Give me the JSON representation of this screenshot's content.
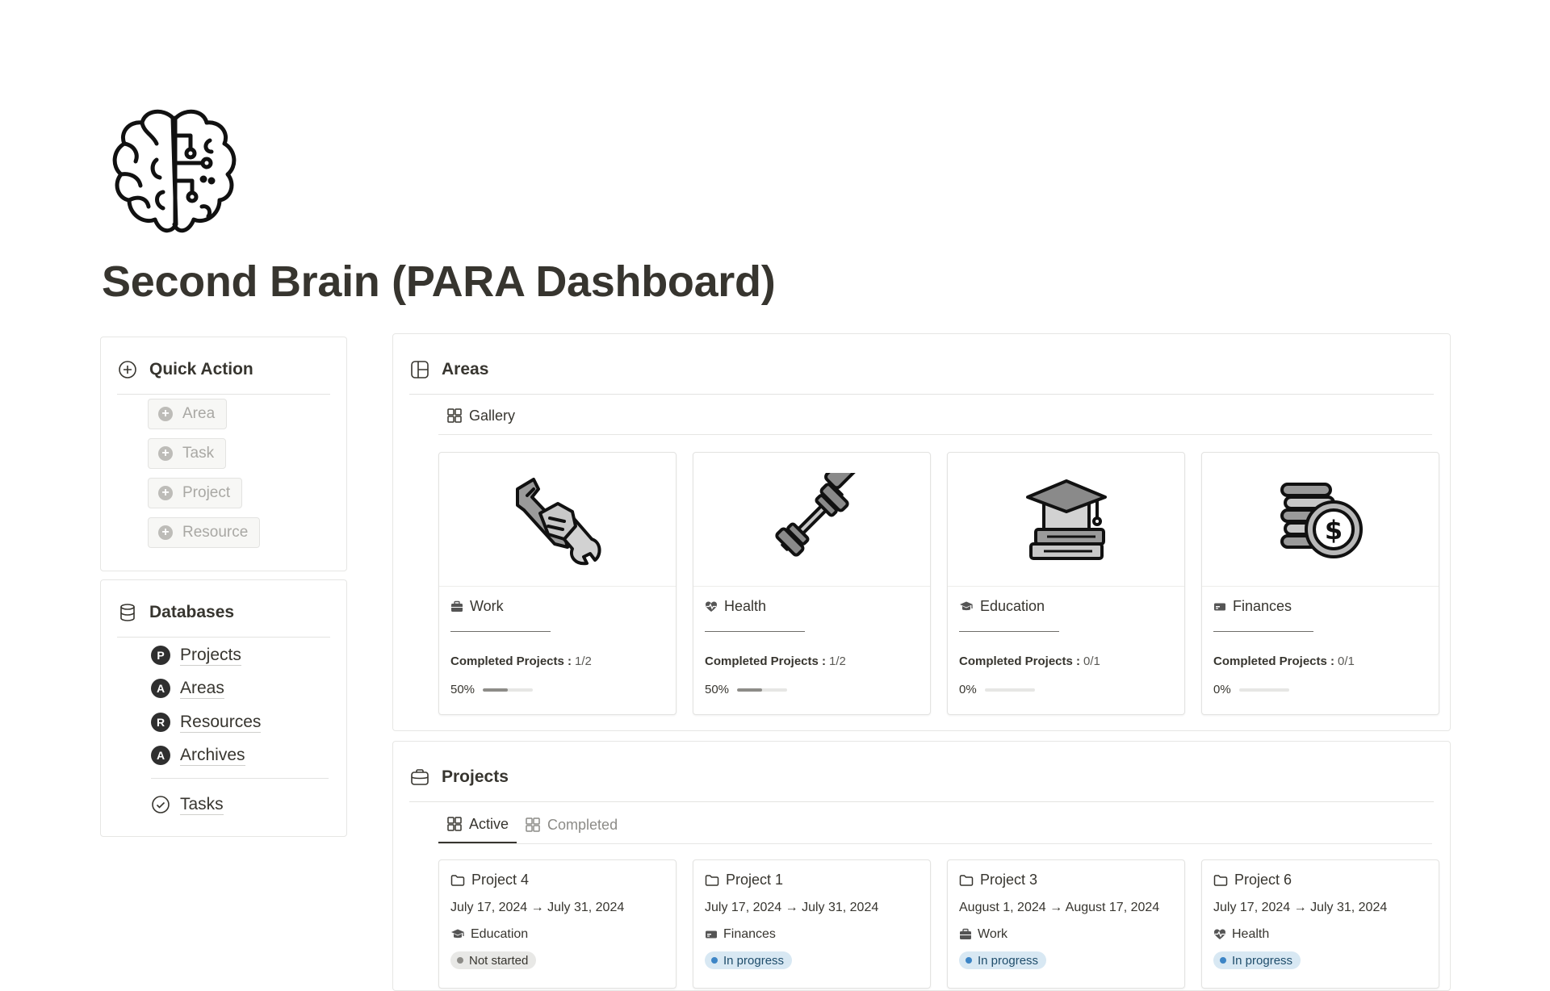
{
  "page": {
    "title": "Second Brain (PARA Dashboard)",
    "icon": "brain-circuit-icon"
  },
  "quick_action": {
    "title": "Quick Action",
    "buttons": [
      {
        "label": "Area"
      },
      {
        "label": "Task"
      },
      {
        "label": "Project"
      },
      {
        "label": "Resource"
      }
    ]
  },
  "databases": {
    "title": "Databases",
    "items": [
      {
        "badge": "P",
        "label": "Projects"
      },
      {
        "badge": "A",
        "label": "Areas"
      },
      {
        "badge": "R",
        "label": "Resources"
      },
      {
        "badge": "A",
        "label": "Archives"
      }
    ],
    "tasks_label": "Tasks"
  },
  "areas": {
    "title": "Areas",
    "view_tab": "Gallery",
    "completed_label": "Completed Projects :",
    "cards": [
      {
        "name": "Work",
        "icon": "briefcase-icon",
        "cover": "tools-icon",
        "completed": "1/2",
        "percent_label": "50%",
        "progress": 0.5
      },
      {
        "name": "Health",
        "icon": "heart-pulse-icon",
        "cover": "dumbbell-icon",
        "completed": "1/2",
        "percent_label": "50%",
        "progress": 0.5
      },
      {
        "name": "Education",
        "icon": "graduation-cap-icon",
        "cover": "graduation-books-icon",
        "completed": "0/1",
        "percent_label": "0%",
        "progress": 0
      },
      {
        "name": "Finances",
        "icon": "money-icon",
        "cover": "coins-icon",
        "completed": "0/1",
        "percent_label": "0%",
        "progress": 0
      }
    ]
  },
  "projects": {
    "title": "Projects",
    "tabs": [
      {
        "label": "Active"
      },
      {
        "label": "Completed"
      }
    ],
    "cards": [
      {
        "name": "Project 4",
        "dates": "July 17, 2024 → July 31, 2024",
        "area": "Education",
        "area_icon": "graduation-cap-icon",
        "status": "Not started"
      },
      {
        "name": "Project 1",
        "dates": "July 17, 2024 → July 31, 2024",
        "area": "Finances",
        "area_icon": "money-icon",
        "status": "In progress"
      },
      {
        "name": "Project 3",
        "dates": "August 1, 2024 → August 17, 2024",
        "area": "Work",
        "area_icon": "briefcase-icon",
        "status": "In progress"
      },
      {
        "name": "Project 6",
        "dates": "July 17, 2024 → July 31, 2024",
        "area": "Health",
        "area_icon": "heart-pulse-icon",
        "status": "In progress"
      }
    ]
  }
}
